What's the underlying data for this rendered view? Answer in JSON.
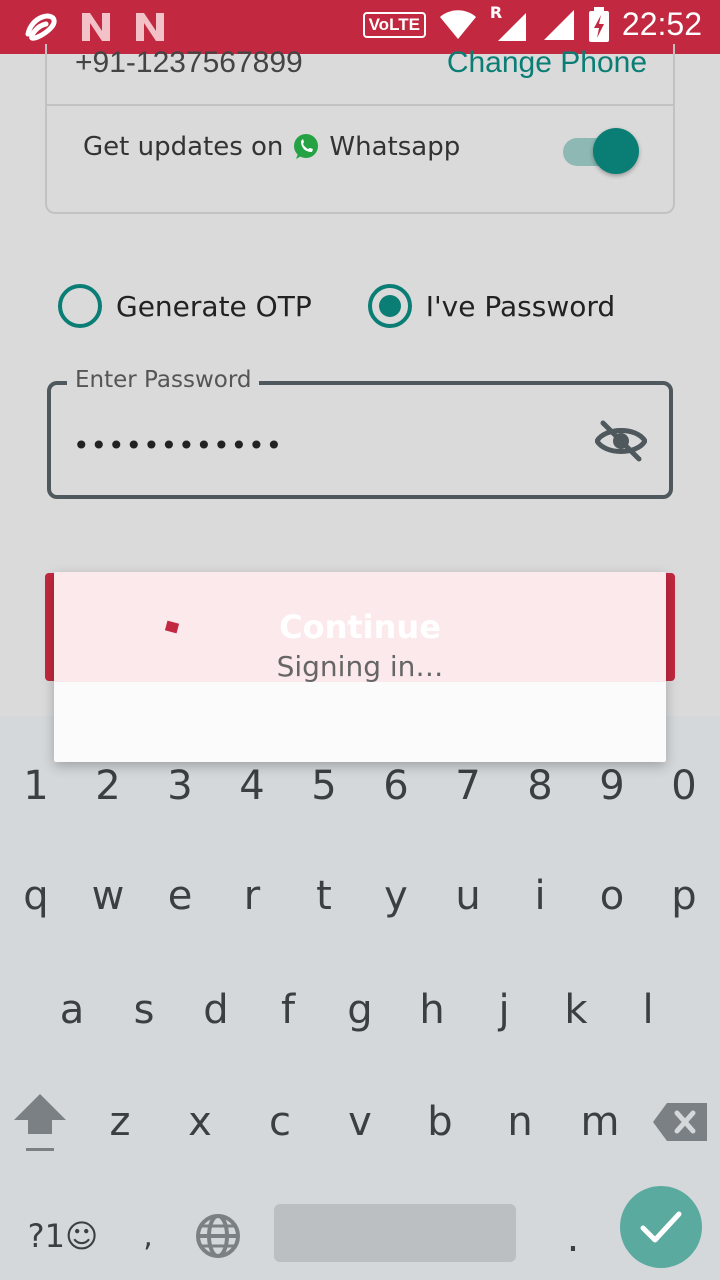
{
  "status_bar": {
    "time": "22:52",
    "volte": "VoLTE",
    "roaming": "R"
  },
  "account": {
    "phone": "+91-1237567899",
    "change_phone": "Change Phone",
    "whatsapp_prefix": "Get updates on",
    "whatsapp_label": "Whatsapp",
    "whatsapp_enabled": true
  },
  "login_method": {
    "options": [
      "Generate OTP",
      "I've Password"
    ],
    "selected": "I've Password"
  },
  "password": {
    "label": "Enter Password",
    "value": "••••••••••••"
  },
  "continue_label": "Continue",
  "dialog": {
    "message": "Signing in…"
  },
  "keyboard": {
    "numbers": [
      "1",
      "2",
      "3",
      "4",
      "5",
      "6",
      "7",
      "8",
      "9",
      "0"
    ],
    "row1": [
      "q",
      "w",
      "e",
      "r",
      "t",
      "y",
      "u",
      "i",
      "o",
      "p"
    ],
    "row2": [
      "a",
      "s",
      "d",
      "f",
      "g",
      "h",
      "j",
      "k",
      "l"
    ],
    "row3": [
      "z",
      "x",
      "c",
      "v",
      "b",
      "n",
      "m"
    ],
    "symbols": "?1☺",
    "comma": ",",
    "period": "."
  },
  "colors": {
    "brand": "#c2283f",
    "accent": "#0a7e75"
  }
}
